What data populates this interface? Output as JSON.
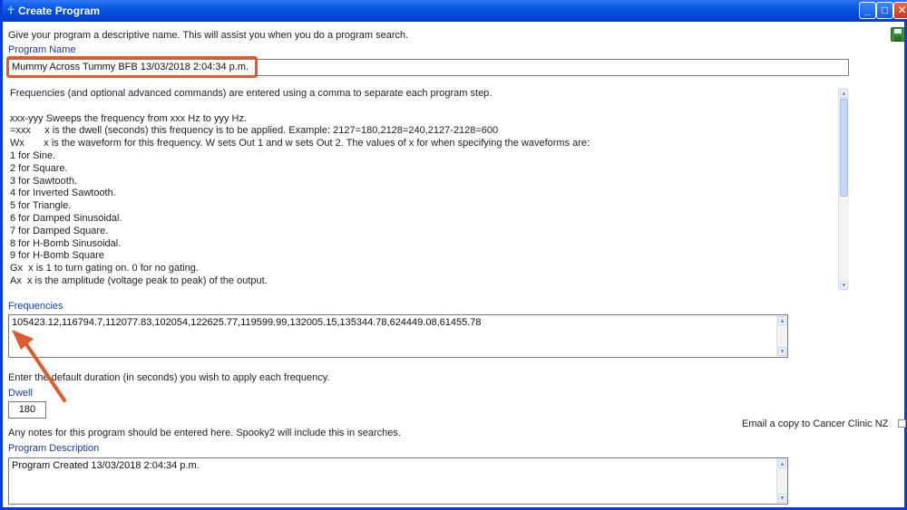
{
  "window": {
    "title": "Create Program"
  },
  "intro": "Give your program a descriptive name. This will assist you when you do a program search.",
  "program_name": {
    "label": "Program Name",
    "value": "Mummy Across Tummy BFB 13/03/2018 2:04:34 p.m."
  },
  "help_lines": [
    "Frequencies (and optional advanced commands) are entered using a comma to separate each program step.",
    "",
    "xxx-yyy Sweeps the frequency from xxx Hz to yyy Hz.",
    "=xxx     x is the dwell (seconds) this frequency is to be applied. Example: 2127=180,2128=240,2127-2128=600",
    "Wx       x is the waveform for this frequency. W sets Out 1 and w sets Out 2. The values of x for when specifying the waveforms are:",
    "1 for Sine.",
    "2 for Square.",
    "3 for Sawtooth.",
    "4 for Inverted Sawtooth.",
    "5 for Triangle.",
    "6 for Damped Sinusoidal.",
    "7 for Damped Square.",
    "8 for H-Bomb Sinusoidal.",
    "9 for H-Bomb Square",
    "Gx  x is 1 to turn gating on. 0 for no gating.",
    "Ax  x is the amplitude (voltage peak to peak) of the output."
  ],
  "frequencies": {
    "label": "Frequencies",
    "value": "105423.12,116794.7,112077.83,102054,122625.77,119599.99,132005.15,135344.78,624449.08,61455.78"
  },
  "dwell": {
    "instruction": "Enter the default duration (in seconds) you wish to apply each frequency.",
    "label": "Dwell",
    "value": "180"
  },
  "notes_instruction": "Any notes for this program should be entered here. Spooky2 will include this in searches.",
  "email_copy": {
    "label": "Email a copy to Cancer Clinic NZ",
    "checked": false
  },
  "description": {
    "label": "Program Description",
    "value": "Program Created 13/03/2018 2:04:34 p.m."
  },
  "colors": {
    "titlebar": "#0a5ce6",
    "label_blue": "#1a3a9a",
    "annotation": "#e05a2b"
  }
}
